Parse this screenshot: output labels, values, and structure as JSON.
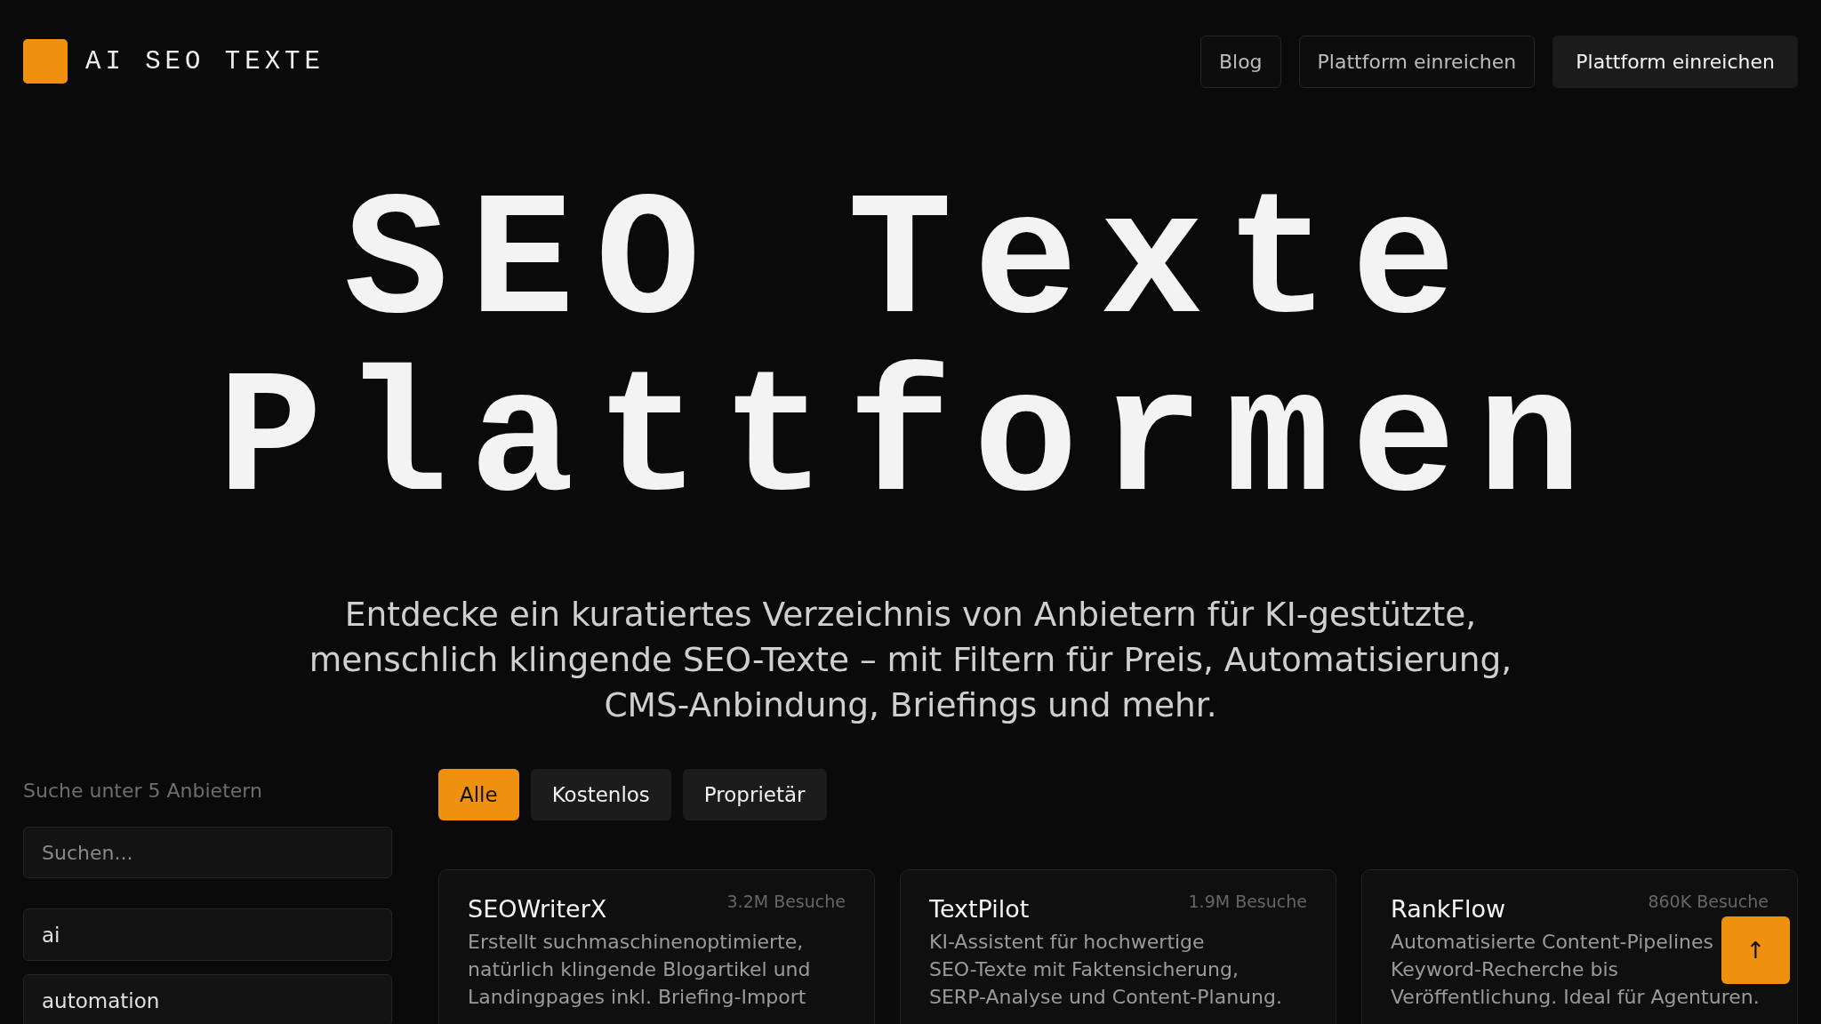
{
  "header": {
    "logo_text": "AI SEO TEXTE",
    "nav": [
      {
        "label": "Blog",
        "kind": "outline"
      },
      {
        "label": "Plattform einreichen",
        "kind": "outline"
      },
      {
        "label": "Plattform einreichen",
        "kind": "filled"
      }
    ]
  },
  "hero": {
    "title_lines": [
      "SEO Texte",
      "Plattformen"
    ],
    "subtitle": "Entdecke ein kuratiertes Verzeichnis von Anbietern für KI-gestützte, menschlich klingende SEO-Texte – mit Filtern für Preis, Automatisierung, CMS-Anbindung, Briefings und mehr."
  },
  "sidebar": {
    "label": "Suche unter 5 Anbietern",
    "search": {
      "placeholder": "Suchen..."
    },
    "tags": [
      "ai",
      "automation"
    ]
  },
  "filters": [
    {
      "label": "Alle",
      "selected": true
    },
    {
      "label": "Kostenlos",
      "selected": false
    },
    {
      "label": "Proprietär",
      "selected": false
    }
  ],
  "cards": [
    {
      "name": "SEOWriterX",
      "visits": "3.2M Besuche",
      "description_lines": [
        "Erstellt suchmaschinenoptimierte,",
        "natürlich klingende Blogartikel und",
        "Landingpages inkl. Briefing-Import"
      ]
    },
    {
      "name": "TextPilot",
      "visits": "1.9M Besuche",
      "description_lines": [
        "KI-Assistent für hochwertige",
        "SEO-Texte mit Faktensicherung,",
        "SERP-Analyse und Content-Planung."
      ]
    },
    {
      "name": "RankFlow",
      "visits": "860K Besuche",
      "description_lines": [
        "Automatisierte Content-Pipelines",
        "Keyword-Recherche bis",
        "Veröffentlichung. Ideal für Agenturen."
      ]
    }
  ],
  "scroll_top": {
    "label": "↑"
  }
}
